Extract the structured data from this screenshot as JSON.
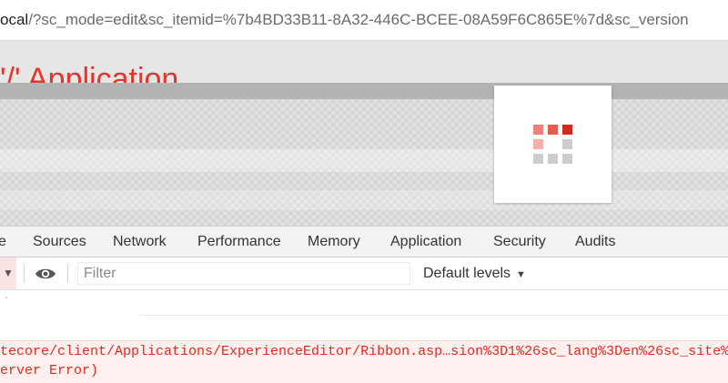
{
  "urlbar": {
    "host_fragment": "ocal",
    "path": "/?sc_mode=edit&sc_itemid=%7b4BD33B11-8A32-446C-BCEE-08A59F6C865E%7d&sc_version"
  },
  "page": {
    "title_fragment": "'/' Application"
  },
  "spinner": {
    "colors": [
      "#f08080",
      "#e85a50",
      "#d42a1e",
      "#f5b0aa",
      "#ffffff",
      "#cccccc",
      "#cccccc",
      "#cccccc",
      "#cccccc"
    ]
  },
  "devtools": {
    "tabs": [
      {
        "label": "e"
      },
      {
        "label": "Sources"
      },
      {
        "label": "Network"
      },
      {
        "label": "Performance"
      },
      {
        "label": "Memory"
      },
      {
        "label": "Application"
      },
      {
        "label": "Security"
      },
      {
        "label": "Audits"
      }
    ],
    "toolbar": {
      "filter_placeholder": "Filter",
      "levels_label": "Default levels",
      "levels_arrow": "▼",
      "left_caret": "▼"
    },
    "console": {
      "prompt_mark": "'",
      "error_line1": "tecore/client/Applications/ExperienceEditor/Ribbon.asp…sion%3D1%26sc_lang%3Den%26sc_site%3D",
      "error_line2": "erver Error)"
    }
  },
  "colors": {
    "error_red": "#e3291f",
    "title_red": "#e5342c"
  }
}
